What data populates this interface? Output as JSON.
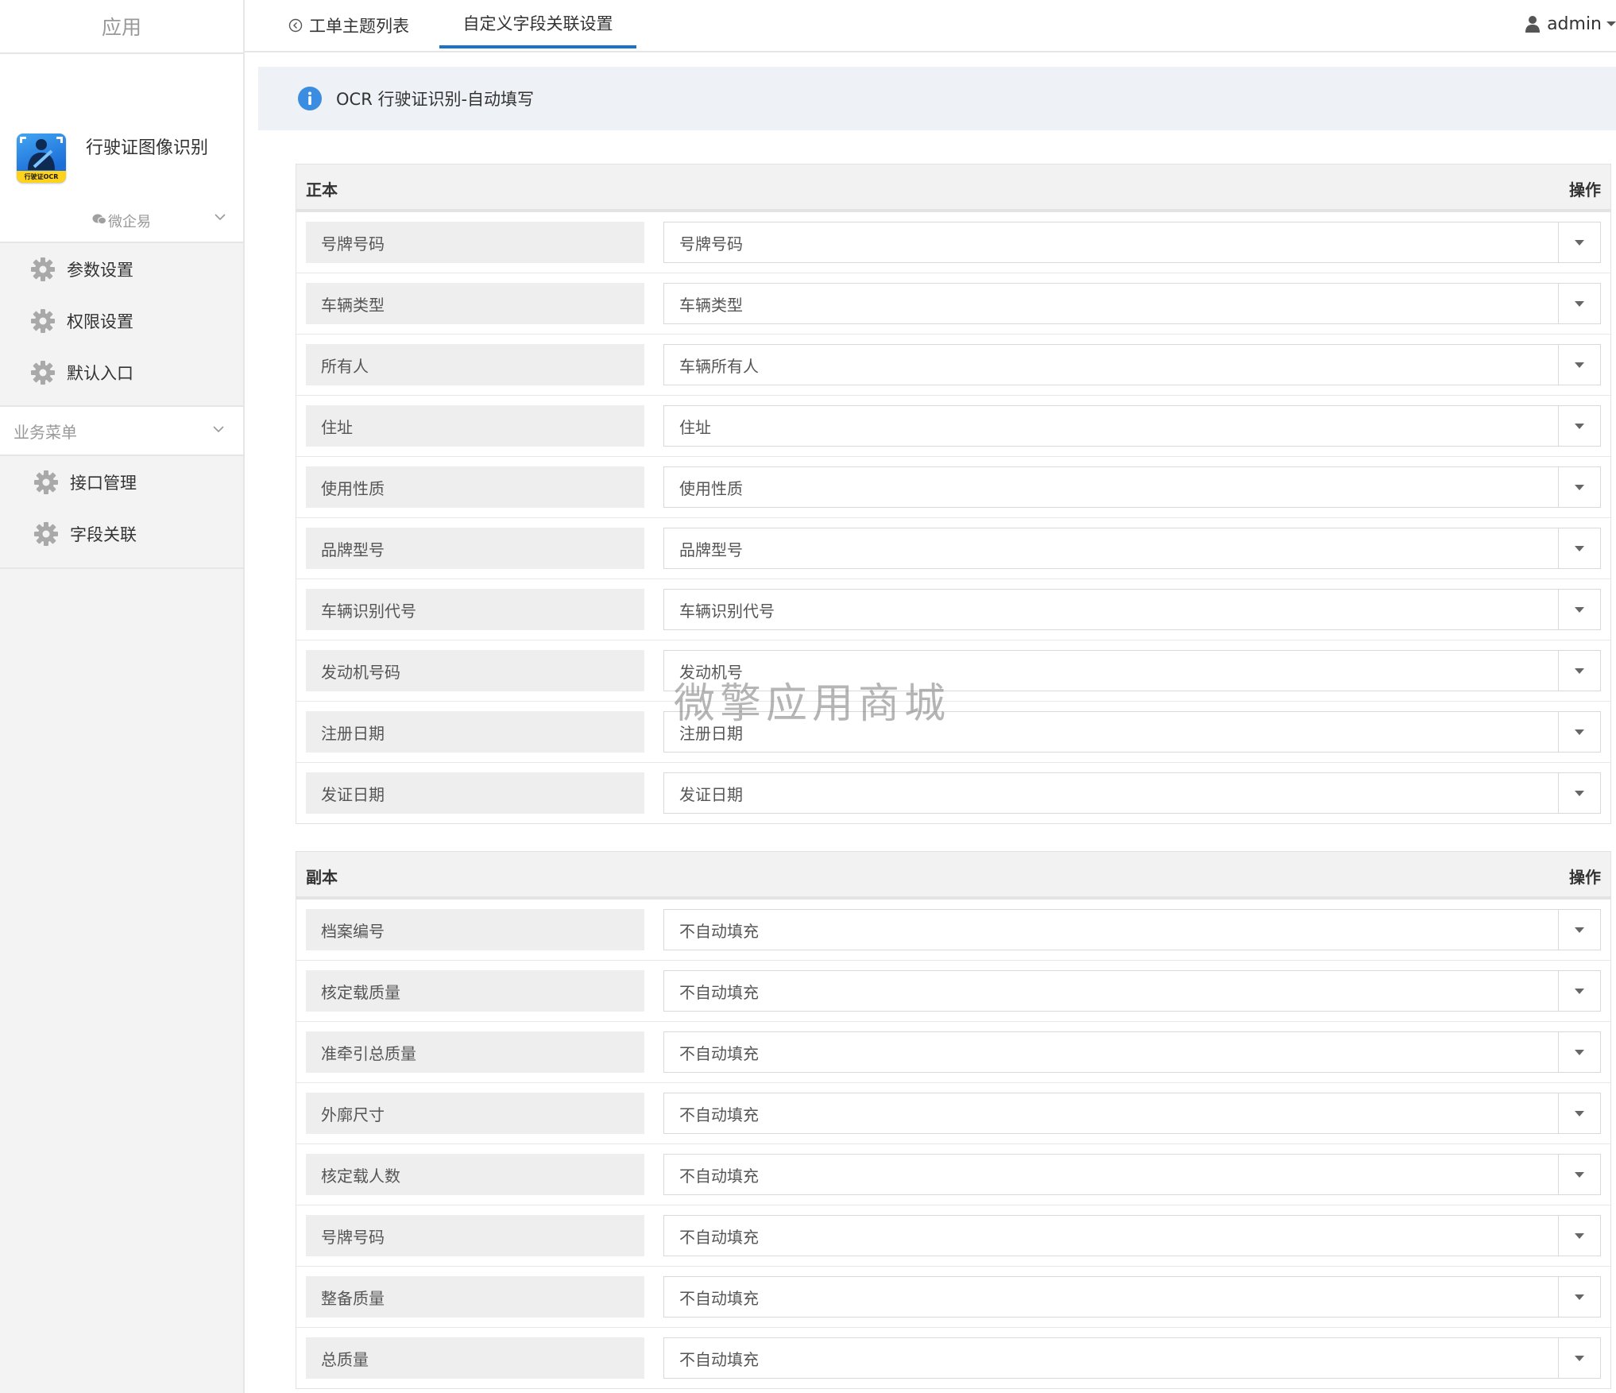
{
  "sidebar": {
    "header": "应用",
    "app_name": "行驶证图像识别",
    "logo_text": "行驶证OCR",
    "corp_label": "微企易",
    "settings_items": [
      {
        "label": "参数设置"
      },
      {
        "label": "权限设置"
      },
      {
        "label": "默认入口"
      }
    ],
    "business_section": "业务菜单",
    "business_items": [
      {
        "label": "接口管理"
      },
      {
        "label": "字段关联"
      }
    ]
  },
  "topbar": {
    "back_tab": "工单主题列表",
    "active_tab": "自定义字段关联设置",
    "user": "admin"
  },
  "notice": "OCR 行驶证识别-自动填写",
  "panel1": {
    "title": "正本",
    "op": "操作",
    "rows": [
      {
        "label": "号牌号码",
        "value": "号牌号码"
      },
      {
        "label": "车辆类型",
        "value": "车辆类型"
      },
      {
        "label": "所有人",
        "value": "车辆所有人"
      },
      {
        "label": "住址",
        "value": "住址"
      },
      {
        "label": "使用性质",
        "value": "使用性质"
      },
      {
        "label": "品牌型号",
        "value": "品牌型号"
      },
      {
        "label": "车辆识别代号",
        "value": "车辆识别代号"
      },
      {
        "label": "发动机号码",
        "value": "发动机号"
      },
      {
        "label": "注册日期",
        "value": "注册日期"
      },
      {
        "label": "发证日期",
        "value": "发证日期"
      }
    ]
  },
  "panel2": {
    "title": "副本",
    "op": "操作",
    "rows": [
      {
        "label": "档案编号",
        "value": "不自动填充"
      },
      {
        "label": "核定载质量",
        "value": "不自动填充"
      },
      {
        "label": "准牵引总质量",
        "value": "不自动填充"
      },
      {
        "label": "外廓尺寸",
        "value": "不自动填充"
      },
      {
        "label": "核定载人数",
        "value": "不自动填充"
      },
      {
        "label": "号牌号码",
        "value": "不自动填充"
      },
      {
        "label": "整备质量",
        "value": "不自动填充"
      },
      {
        "label": "总质量",
        "value": "不自动填充"
      }
    ]
  },
  "watermark": "微擎应用商城",
  "colors": {
    "accent": "#1d71c9",
    "info": "#3a8de0",
    "sidebar_bg": "#f3f3f3",
    "notice_bg": "#eef1f5",
    "label_bg": "#eeeeee",
    "logo_band": "#ffd21c"
  },
  "icons": [
    "gear-icon",
    "chevron-down-icon",
    "back-circle-icon",
    "user-icon",
    "info-icon",
    "dropdown-arrow-icon",
    "wechat-icon"
  ]
}
